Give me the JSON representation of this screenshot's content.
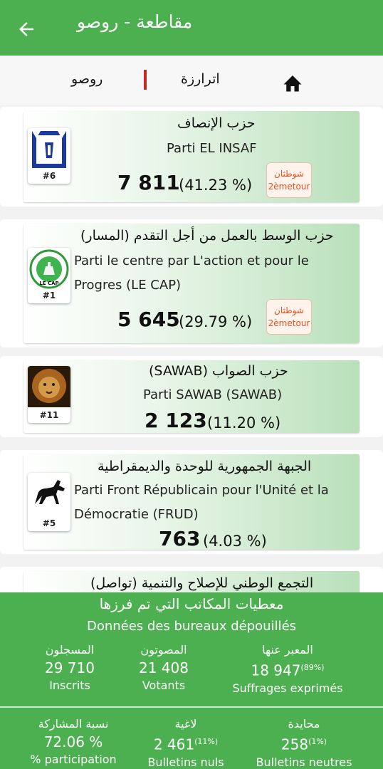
{
  "header": {
    "title": "مقاطعة  - روصو"
  },
  "breadcrumb": {
    "region": "اترارزة",
    "commune": "روصو"
  },
  "parties": [
    {
      "name_ar": "حزب الإنصاف",
      "name_fr": "Parti EL INSAF",
      "number": "#6",
      "votes": "7 811",
      "percent": "(41.23 %)",
      "badge_ar": "شوطثان",
      "badge_fr": "2èmetour"
    },
    {
      "name_ar": "(حزب الوسط بالعمل من أجل التقدم (المسار",
      "name_fr_line1": "Parti le centre par L'action et pour le",
      "name_fr_line2": "Progres  (LE CAP)",
      "number": "#1",
      "logo_text": "LE CAP",
      "votes": "5 645",
      "percent": "(29.79 %)",
      "badge_ar": "شوطثان",
      "badge_fr": "2èmetour"
    },
    {
      "name_ar": "(SAWAB) حزب الصواب",
      "name_fr": "Parti SAWAB (SAWAB)",
      "number": "#11",
      "votes": "2 123",
      "percent": "(11.20 %)"
    },
    {
      "name_ar": "الجبهة الجمهورية للوحدة والديمقراطية",
      "name_fr_line1": "Parti Front Républicain pour l'Unité et la",
      "name_fr_line2": "Démocratie  (FRUD)",
      "number": "#5",
      "votes": "763",
      "percent": "(4.03 %)"
    },
    {
      "name_ar": "(التجمع الوطني للإصلاح والتنمية (تواصل"
    }
  ],
  "stats": {
    "title_ar": "معطيات المكاتب التي تم فرزها",
    "title_fr": "Données des bureaux dépouillés",
    "registered": {
      "label_ar": "المسجلون",
      "value": "29 710",
      "label_fr": "Inscrits"
    },
    "voters": {
      "label_ar": "المصوتون",
      "value": "21 408",
      "label_fr": "Votants"
    },
    "expressed": {
      "label_ar": "المعبر عنها",
      "value": "18 947",
      "pct": "(89%)",
      "label_fr": "Suffrages exprimés"
    },
    "participation": {
      "label_ar": "نسبة المشاركة",
      "value": "72.06 %",
      "label_fr": "% participation"
    },
    "null_votes": {
      "label_ar": "لاغية",
      "value": "2 461",
      "pct": "(11%)",
      "label_fr": "Bulletins nuls"
    },
    "neutral_votes": {
      "label_ar": "محايدة",
      "value": "258",
      "pct": "(1%)",
      "label_fr": "Bulletins neutres"
    }
  },
  "colors": {
    "primary": "#4caf50",
    "divider_red": "#c62828",
    "badge_text": "#e6501c"
  }
}
